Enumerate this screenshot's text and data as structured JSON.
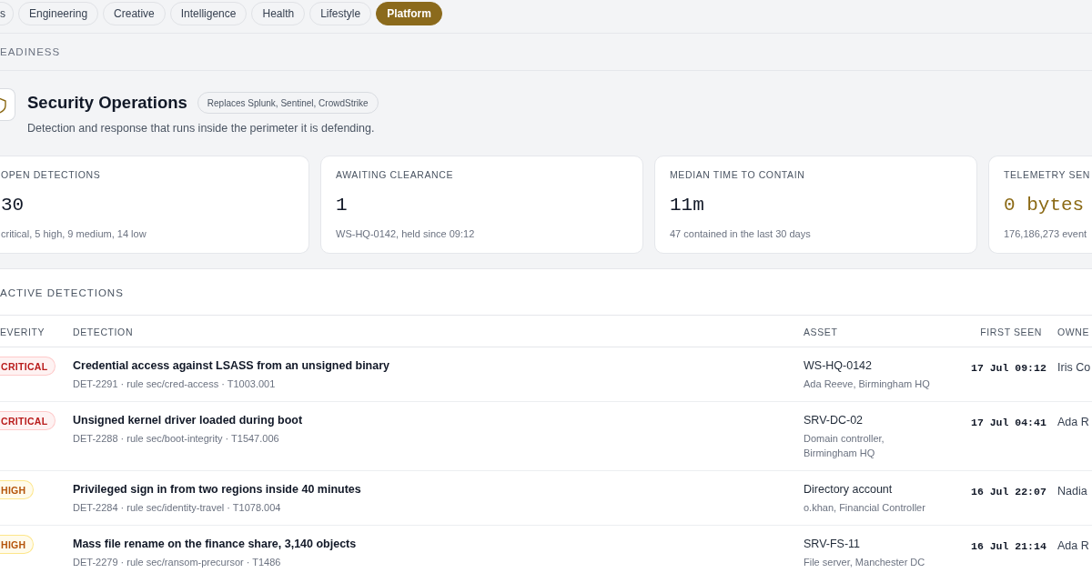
{
  "category_tabs": [
    {
      "label": "s",
      "selected": false
    },
    {
      "label": "Engineering",
      "selected": false
    },
    {
      "label": "Creative",
      "selected": false
    },
    {
      "label": "Intelligence",
      "selected": false
    },
    {
      "label": "Health",
      "selected": false
    },
    {
      "label": "Lifestyle",
      "selected": false
    },
    {
      "label": "Platform",
      "selected": true
    }
  ],
  "section_heading": "EADINESS",
  "module": {
    "title": "Security Operations",
    "tag": "Replaces Splunk, Sentinel, CrowdStrike",
    "description": "Detection and response that runs inside the perimeter it is defending."
  },
  "stats": [
    {
      "label": "OPEN DETECTIONS",
      "value": "30",
      "note": "critical, 5 high, 9 medium, 14 low",
      "highlighted": false
    },
    {
      "label": "AWAITING CLEARANCE",
      "value": "1",
      "note": "WS-HQ-0142, held since 09:12",
      "highlighted": false
    },
    {
      "label": "MEDIAN TIME TO CONTAIN",
      "value": "11m",
      "note": "47 contained in the last 30 days",
      "highlighted": false
    },
    {
      "label": "TELEMETRY SEN",
      "value": "0 bytes",
      "note": "176,186,273 event",
      "highlighted": true
    }
  ],
  "detections": {
    "title": "ACTIVE DETECTIONS",
    "columns": [
      "EVERITY",
      "DETECTION",
      "ASSET",
      "FIRST SEEN",
      "OWNE"
    ],
    "rows": [
      {
        "severity": {
          "label": "CRITICAL",
          "kind": "critical"
        },
        "title": "Credential access against LSASS from an unsigned binary",
        "meta": "DET-2291 · rule sec/cred-access · T1003.001",
        "asset": "WS-HQ-0142",
        "asset_detail": "Ada Reeve, Birmingham HQ",
        "first_seen": "17 Jul 09:12",
        "owner": "Iris Co"
      },
      {
        "severity": {
          "label": "CRITICAL",
          "kind": "critical"
        },
        "title": "Unsigned kernel driver loaded during boot",
        "meta": "DET-2288 · rule sec/boot-integrity · T1547.006",
        "asset": "SRV-DC-02",
        "asset_detail": "Domain controller, Birmingham HQ",
        "first_seen": "17 Jul 04:41",
        "owner": "Ada R"
      },
      {
        "severity": {
          "label": "HIGH",
          "kind": "high"
        },
        "title": "Privileged sign in from two regions inside 40 minutes",
        "meta": "DET-2284 · rule sec/identity-travel · T1078.004",
        "asset": "Directory account",
        "asset_detail": "o.khan, Financial Controller",
        "first_seen": "16 Jul 22:07",
        "owner": "Nadia"
      },
      {
        "severity": {
          "label": "HIGH",
          "kind": "high"
        },
        "title": "Mass file rename on the finance share, 3,140 objects",
        "meta": "DET-2279 · rule sec/ransom-precursor · T1486",
        "asset": "SRV-FS-11",
        "asset_detail": "File server, Manchester DC",
        "first_seen": "16 Jul 21:14",
        "owner": "Ada R"
      }
    ]
  }
}
